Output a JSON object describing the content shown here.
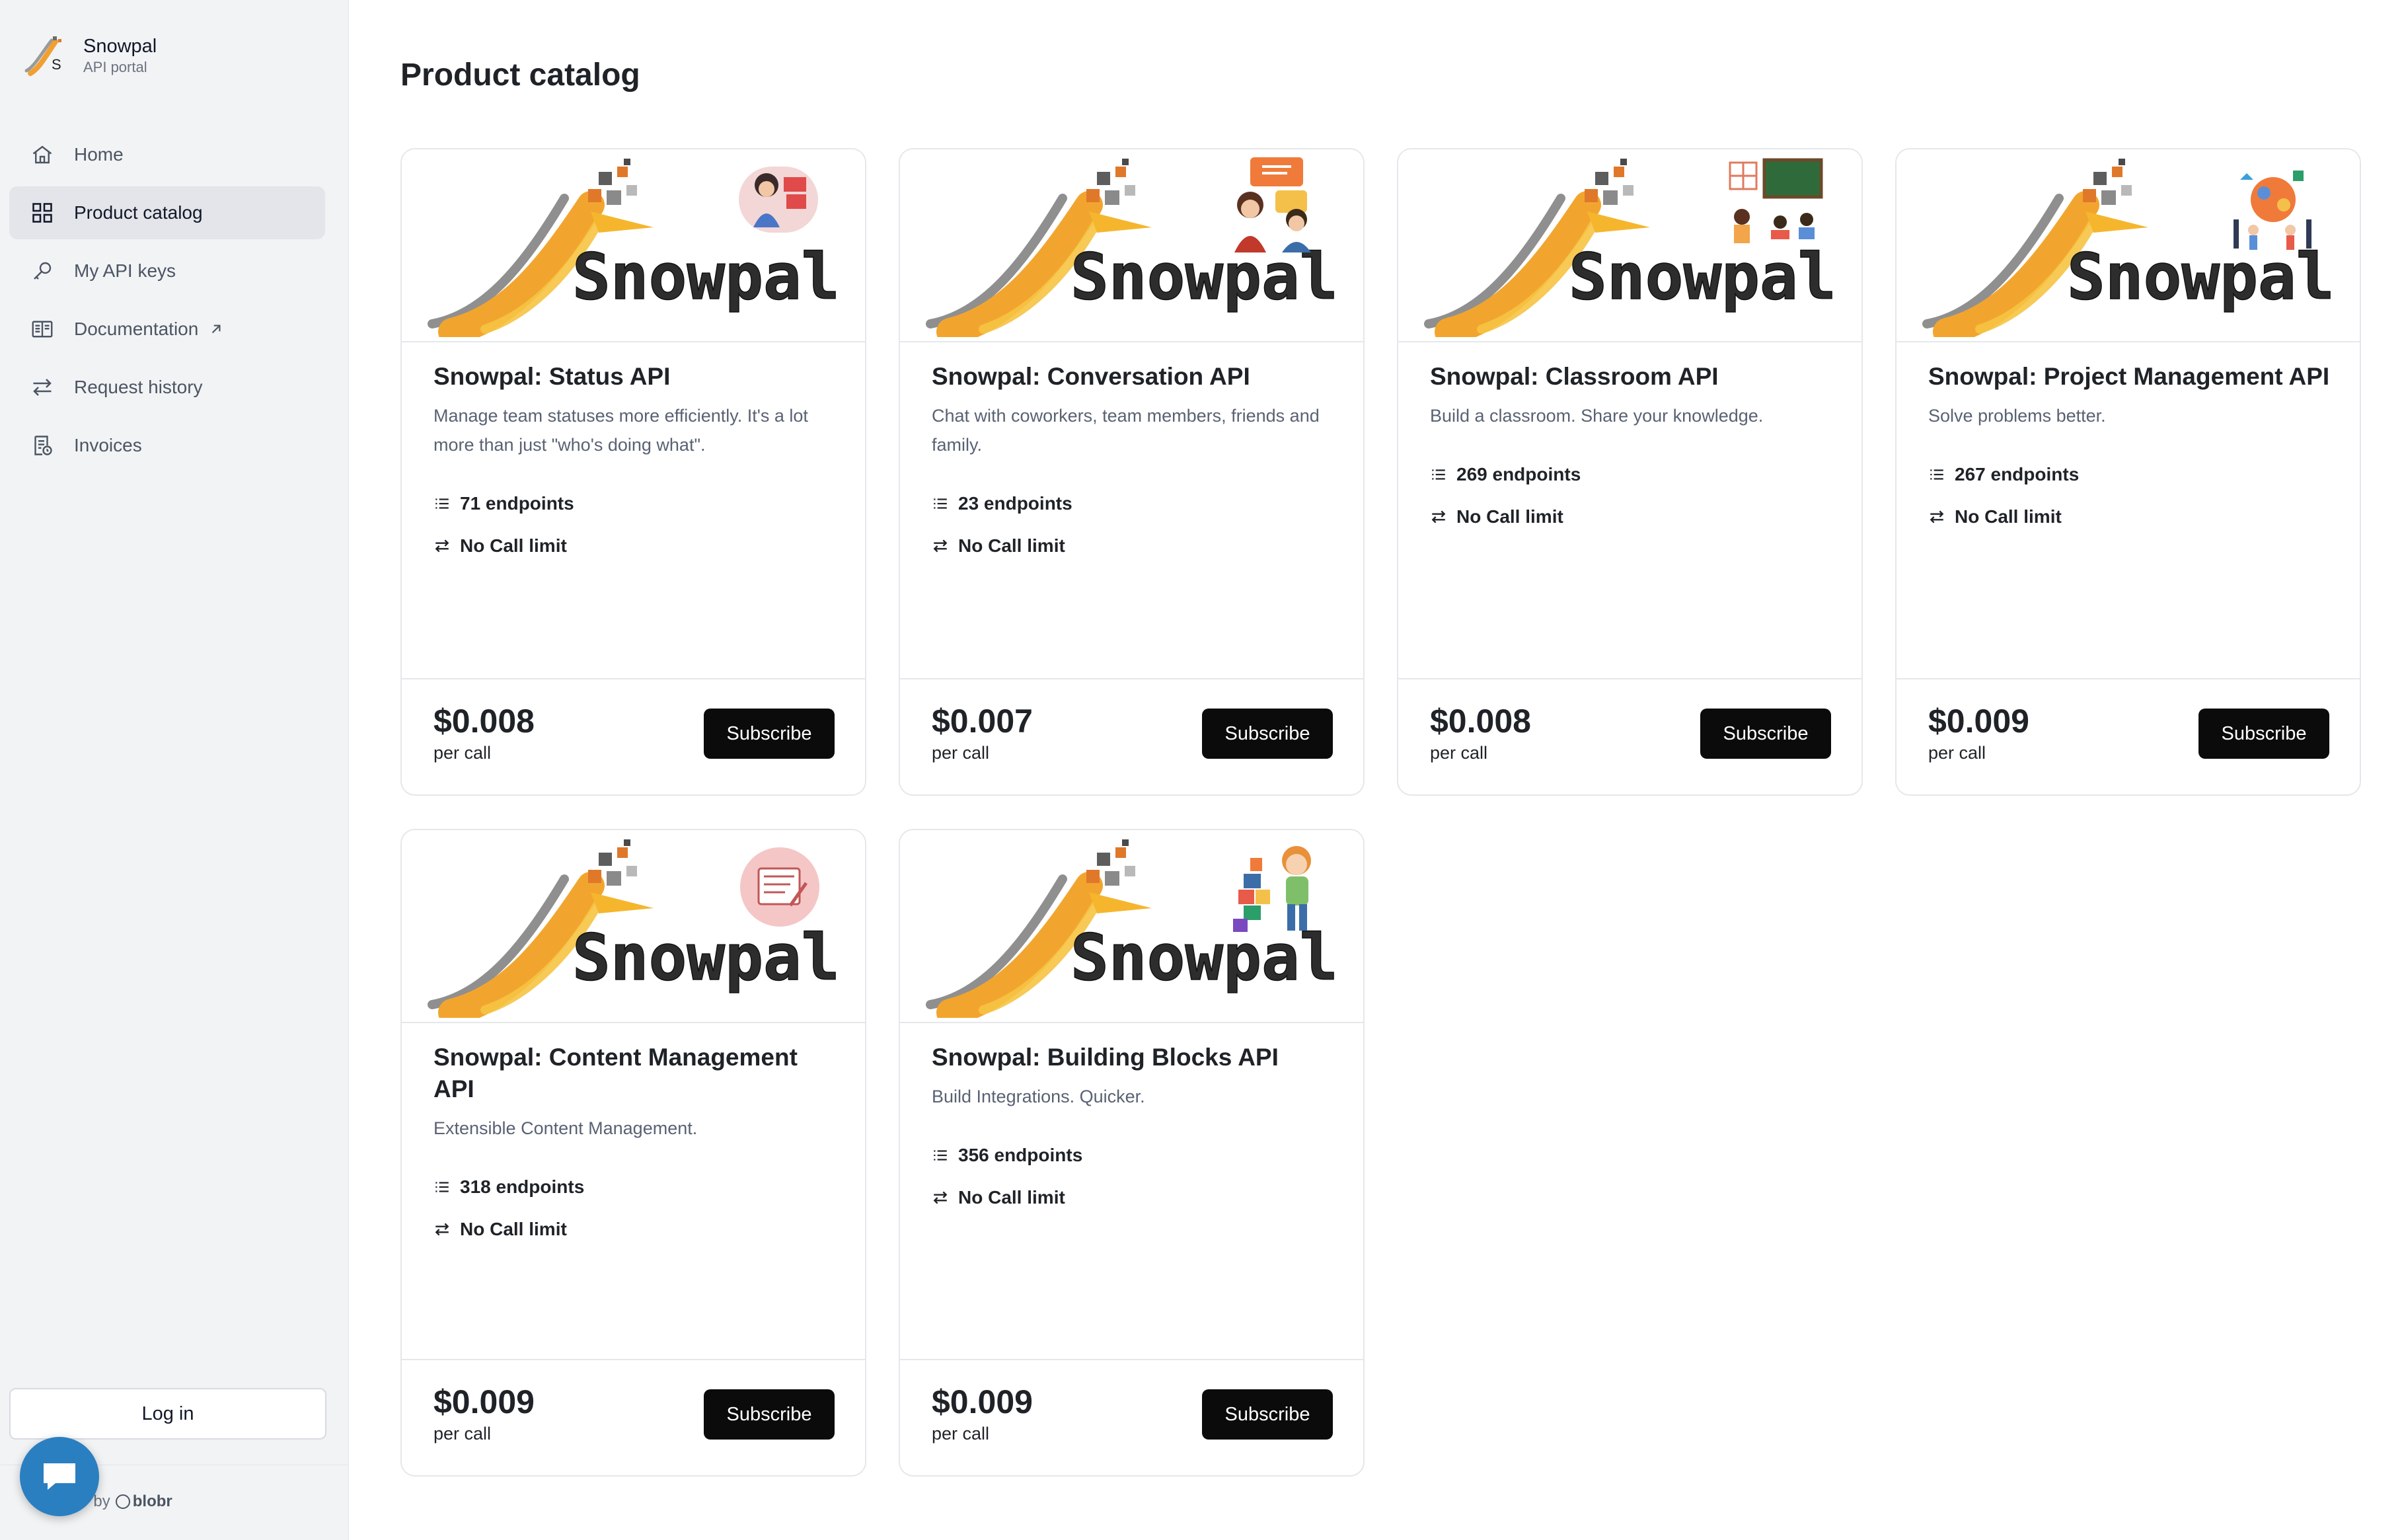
{
  "brand": {
    "name": "Snowpal",
    "subtitle": "API portal"
  },
  "nav": [
    {
      "label": "Home",
      "icon": "home-icon"
    },
    {
      "label": "Product catalog",
      "icon": "grid-icon",
      "active": true
    },
    {
      "label": "My API keys",
      "icon": "key-icon"
    },
    {
      "label": "Documentation",
      "icon": "book-icon",
      "external": true
    },
    {
      "label": "Request history",
      "icon": "arrows-icon"
    },
    {
      "label": "Invoices",
      "icon": "invoice-icon"
    }
  ],
  "login_label": "Log in",
  "powered": {
    "prefix": "by",
    "brand": "blobr"
  },
  "page_title": "Product catalog",
  "banner_word": "Snowpal",
  "colors": {
    "subscribe_bg": "#0b0b0b",
    "chat_bubble": "#2a7fc1",
    "logo_orange": "#f0a030",
    "logo_gray": "#8a8a8a"
  },
  "products": [
    {
      "title": "Snowpal: Status API",
      "description": "Manage team statuses more efficiently. It's a lot more than just \"who's doing what\".",
      "endpoints": "71 endpoints",
      "limit": "No Call limit",
      "price": "$0.008",
      "unit": "per call",
      "cta": "Subscribe",
      "illustration": "woman-with-panels-illustration"
    },
    {
      "title": "Snowpal: Conversation API",
      "description": "Chat with coworkers, team members, friends and family.",
      "endpoints": "23 endpoints",
      "limit": "No Call limit",
      "price": "$0.007",
      "unit": "per call",
      "cta": "Subscribe",
      "illustration": "people-chatting-illustration"
    },
    {
      "title": "Snowpal: Classroom API",
      "description": "Build a classroom. Share your knowledge.",
      "endpoints": "269 endpoints",
      "limit": "No Call limit",
      "price": "$0.008",
      "unit": "per call",
      "cta": "Subscribe",
      "illustration": "classroom-illustration"
    },
    {
      "title": "Snowpal: Project Management API",
      "description": "Solve problems better.",
      "endpoints": "267 endpoints",
      "limit": "No Call limit",
      "price": "$0.009",
      "unit": "per call",
      "cta": "Subscribe",
      "illustration": "team-building-illustration"
    },
    {
      "title": "Snowpal: Content Management API",
      "description": "Extensible Content Management.",
      "endpoints": "318 endpoints",
      "limit": "No Call limit",
      "price": "$0.009",
      "unit": "per call",
      "cta": "Subscribe",
      "illustration": "document-edit-illustration"
    },
    {
      "title": "Snowpal: Building Blocks API",
      "description": "Build Integrations. Quicker.",
      "endpoints": "356 endpoints",
      "limit": "No Call limit",
      "price": "$0.009",
      "unit": "per call",
      "cta": "Subscribe",
      "illustration": "kid-with-blocks-illustration"
    }
  ]
}
